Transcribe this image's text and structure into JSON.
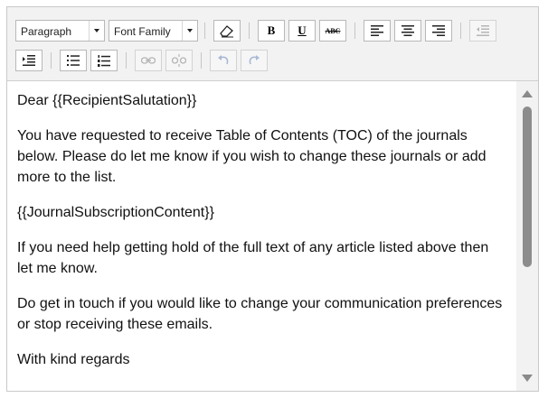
{
  "toolbar": {
    "block_format": "Paragraph",
    "font_family": "Font Family",
    "bold_glyph": "B",
    "underline_glyph": "U",
    "strike_glyph": "ABC"
  },
  "document": {
    "paragraphs": [
      "Dear {{RecipientSalutation}}",
      "You have requested to receive Table of Contents (TOC) of the journals below. Please do let me know if you wish to change these journals or add more to the list.",
      "{{JournalSubscriptionContent}}",
      "If you need help getting hold of the full text of any article listed above then let me know.",
      "Do get in touch if you would like to change your communication preferences or stop receiving these emails.",
      "With kind regards"
    ]
  },
  "scrollbar": {
    "position_fraction": 0.0,
    "visible_fraction": 0.55
  }
}
